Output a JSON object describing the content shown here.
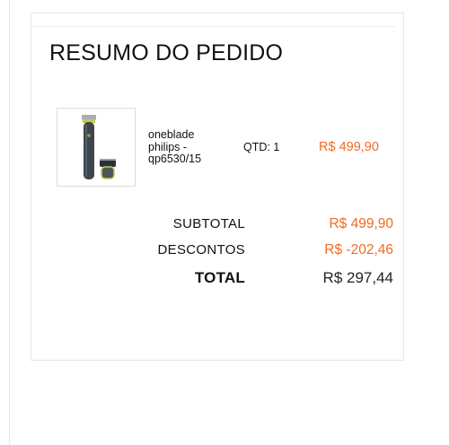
{
  "summary": {
    "title": "RESUMO DO PEDIDO",
    "item": {
      "image": "product-thumbnail",
      "name": "oneblade philips - qp6530/15",
      "qty": "QTD: 1",
      "price": "R$ 499,90"
    },
    "subtotal_label": "SUBTOTAL",
    "subtotal_value": "R$ 499,90",
    "discounts_label": "DESCONTOS",
    "discounts_value": "R$ -202,46",
    "total_label": "TOTAL",
    "total_value": "R$ 297,44"
  },
  "colors": {
    "accent": "#f26b21",
    "text": "#111111",
    "border": "#e6e6e6"
  }
}
